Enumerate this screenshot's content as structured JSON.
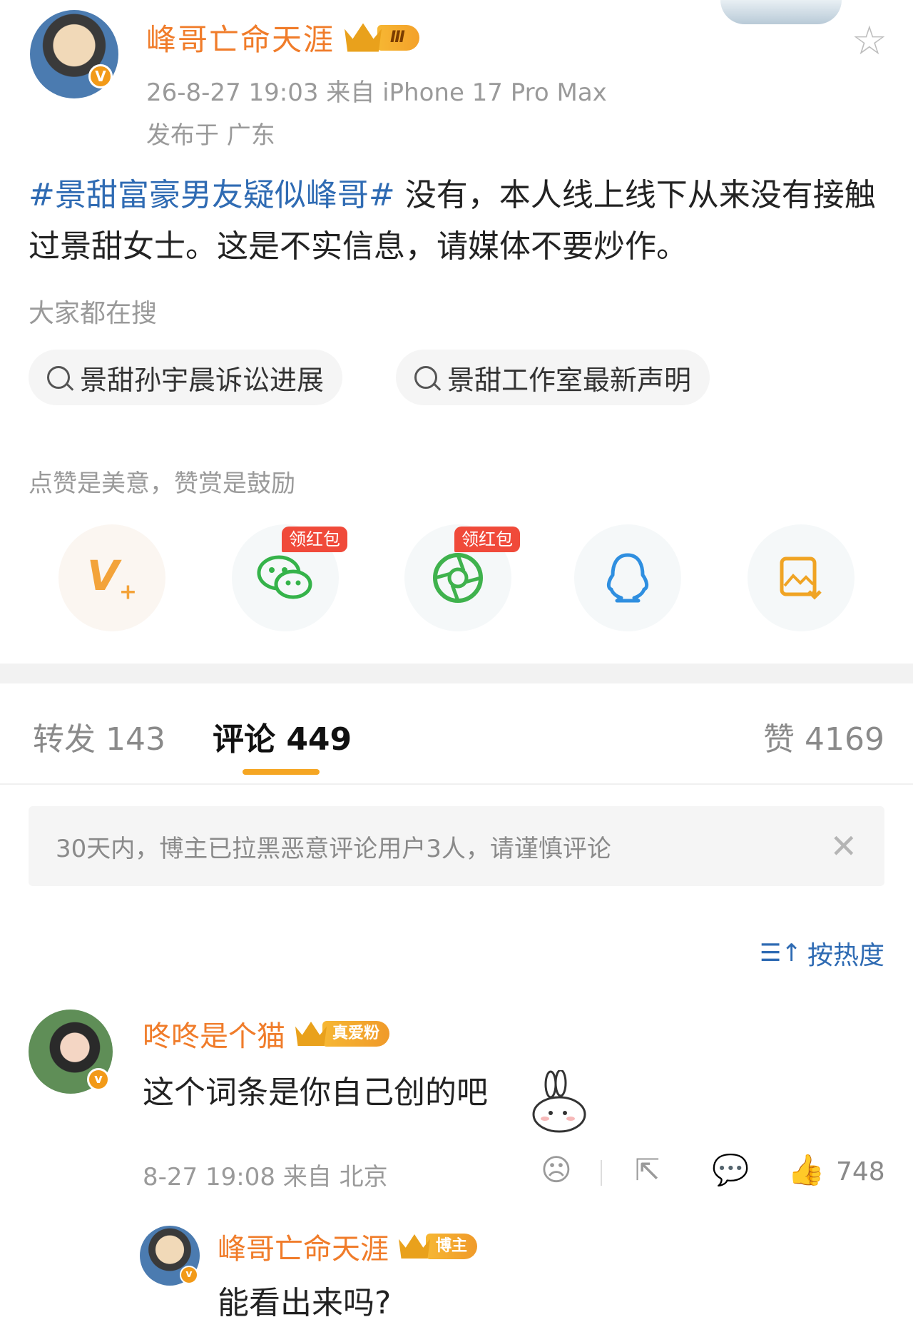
{
  "post": {
    "author": "峰哥亡命天涯",
    "rank_badge": "Ⅲ",
    "verified_mark": "V",
    "time_source": "26-8-27 19:03  来自 iPhone 17 Pro Max",
    "location": "发布于 广东",
    "hashtag": "#景甜富豪男友疑似峰哥#",
    "text": " 没有，本人线上线下从来没有接触过景甜女士。这是不实信息，请媒体不要炒作。"
  },
  "search": {
    "title": "大家都在搜",
    "items": [
      "景甜孙宇晨诉讼进展",
      "景甜工作室最新声明"
    ]
  },
  "reward": {
    "tip": "点赞是美意，赞赏是鼓励",
    "redpacket_label": "领红包"
  },
  "tabs": {
    "repost": "转发 143",
    "comments": "评论 449",
    "likes": "赞 4169"
  },
  "notice": "30天内，博主已拉黑恶意评论用户3人，请谨慎评论",
  "sort_label": "按热度",
  "comment": {
    "user": "咚咚是个猫",
    "badge": "真爱粉",
    "text": "这个词条是你自己创的吧",
    "meta": "8-27 19:08  来自 北京",
    "likes": "748"
  },
  "reply": {
    "user": "峰哥亡命天涯",
    "badge": "博主",
    "text": "能看出来吗?"
  },
  "colors": {
    "accent": "#f07c2a",
    "link": "#2f6bb3",
    "tab_underline": "#f5a623",
    "redpacket": "#f04a3a"
  }
}
